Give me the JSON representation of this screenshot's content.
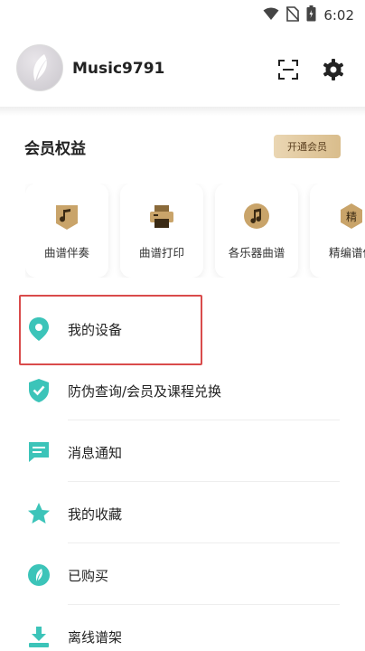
{
  "status_bar": {
    "time": "6:02",
    "icons": [
      "wifi-icon",
      "no-sim-icon",
      "battery-icon"
    ]
  },
  "profile": {
    "username": "Music9791"
  },
  "header_actions": [
    "scan-icon",
    "gear-icon"
  ],
  "member": {
    "title": "会员权益",
    "open_button": "开通会员",
    "cards": [
      {
        "label": "曲谱伴奏",
        "icon": "music-note-icon"
      },
      {
        "label": "曲谱打印",
        "icon": "printer-icon"
      },
      {
        "label": "各乐器曲谱",
        "icon": "music-note-circle-icon"
      },
      {
        "label": "精编谱仿",
        "icon": "jing-badge-icon",
        "icon_text": "精"
      }
    ]
  },
  "menu": [
    {
      "label": "我的设备",
      "icon": "location-pin-icon"
    },
    {
      "label": "防伪查询/会员及课程兑换",
      "icon": "shield-check-icon"
    },
    {
      "label": "消息通知",
      "icon": "message-icon"
    },
    {
      "label": "我的收藏",
      "icon": "star-icon"
    },
    {
      "label": "已购买",
      "icon": "leaf-icon"
    },
    {
      "label": "离线谱架",
      "icon": "download-icon"
    }
  ],
  "colors": {
    "accent": "#3cc4b9",
    "gold": "#c9a46a",
    "highlight": "#d94b4b"
  }
}
